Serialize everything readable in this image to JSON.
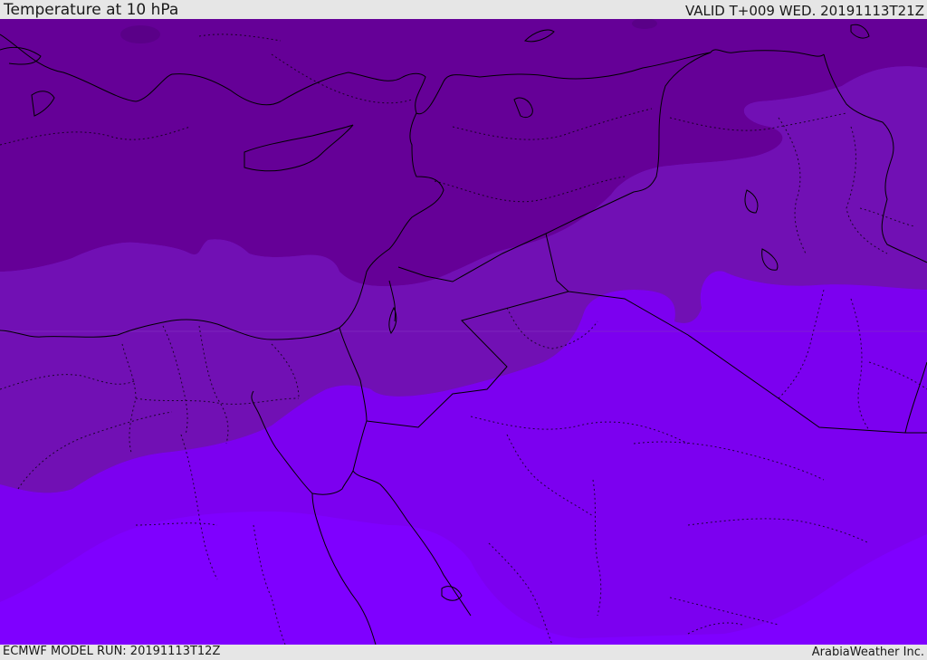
{
  "header": {
    "title": "Temperature at 10 hPa",
    "valid": "VALID T+009 WED. 20191113T21Z"
  },
  "footer": {
    "model_run": "ECMWF MODEL RUN: 20191113T12Z",
    "credit": "ArabiaWeather Inc."
  },
  "map": {
    "field": "Temperature at 10 hPa",
    "colors": {
      "band_1": "#650097",
      "band_2": "#7110b4",
      "band_3": "#7a00d6",
      "band_4": "#7c00f0",
      "band_5": "#7f00ff",
      "borders": "#000000",
      "sea_trace": "#8230c0"
    }
  }
}
